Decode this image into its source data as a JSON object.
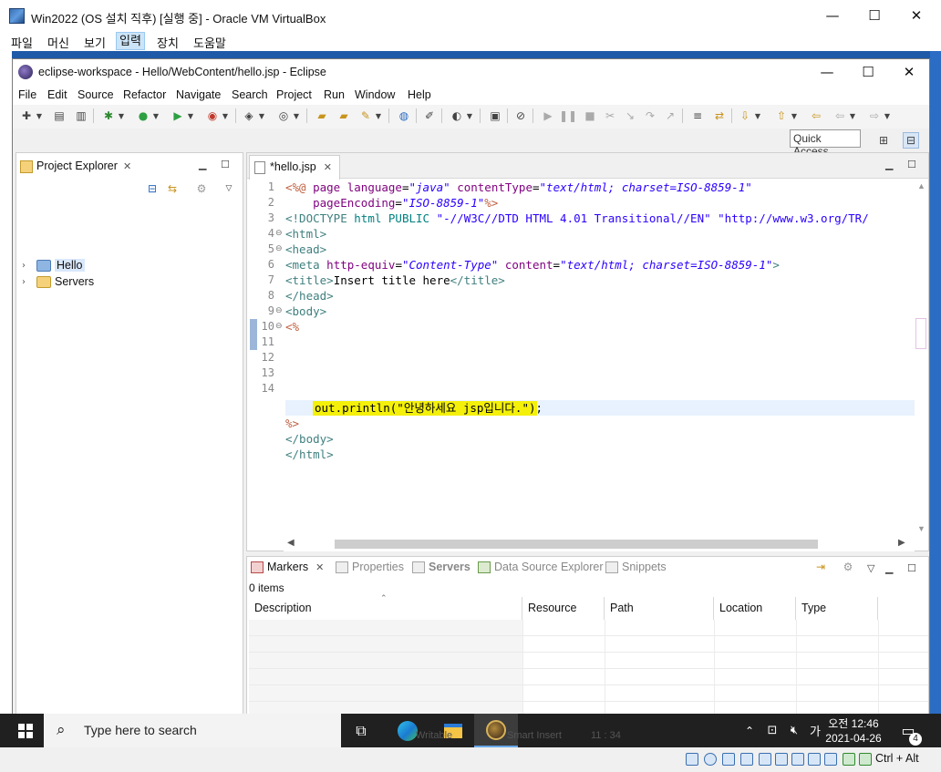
{
  "vbox": {
    "title": "Win2022 (OS 설치 직후) [실행 중] - Oracle VM VirtualBox",
    "menu": [
      "파일",
      "머신",
      "보기",
      "입력",
      "장치",
      "도움말"
    ],
    "active_menu_index": 3,
    "host_key": "Ctrl + Alt"
  },
  "eclipse": {
    "title": "eclipse-workspace - Hello/WebContent/hello.jsp - Eclipse",
    "menu": [
      "File",
      "Edit",
      "Source",
      "Refactor",
      "Navigate",
      "Search",
      "Project",
      "Run",
      "Window",
      "Help"
    ],
    "quick_access": "Quick Access"
  },
  "project_explorer": {
    "tab_label": "Project Explorer",
    "items": [
      {
        "label": "Hello",
        "selected": true
      },
      {
        "label": "Servers",
        "selected": false
      }
    ]
  },
  "editor": {
    "tab_label": "*hello.jsp",
    "line_numbers": [
      "1",
      "2",
      "3",
      "4",
      "5",
      "6",
      "7",
      "8",
      "9",
      "10",
      "11",
      "12",
      "13",
      "14"
    ],
    "current_line": "11",
    "highlighted_text": "out.println(\"안녕하세요 jsp입니다.\");"
  },
  "bottom_panel": {
    "tabs": [
      {
        "label": "Markers",
        "active": true
      },
      {
        "label": "Properties",
        "active": false
      },
      {
        "label": "Servers",
        "active": false
      },
      {
        "label": "Data Source Explorer",
        "active": false
      },
      {
        "label": "Snippets",
        "active": false
      }
    ],
    "item_count": "0 items",
    "columns": [
      "Description",
      "Resource",
      "Path",
      "Location",
      "Type"
    ]
  },
  "taskbar": {
    "search_placeholder": "Type here to search",
    "time": "오전 12:46",
    "date": "2021-04-26",
    "ime": "가",
    "notification_count": "4",
    "hidden_text_a": "Writable",
    "hidden_text_b": "Smart Insert",
    "hidden_text_c": "11 : 34"
  },
  "colors": {
    "guest_background": "#1e5aa8",
    "taskbar": "#202020",
    "highlight": "#f4f00a",
    "jsp_tag": "#bf5f3f",
    "html_tag": "#3f7f7f",
    "attr": "#7f007f",
    "value": "#2a00ff"
  }
}
